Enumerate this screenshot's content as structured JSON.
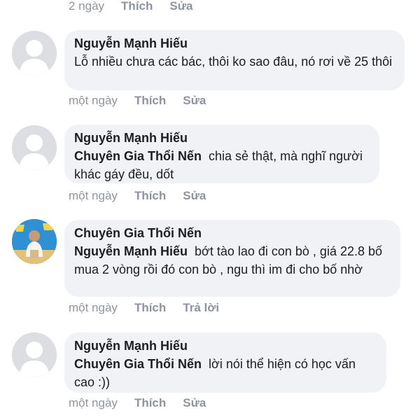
{
  "comments": [
    {
      "time": "2 ngày",
      "actions": [
        "Thích",
        "Sửa"
      ]
    },
    {
      "author": "Nguyễn Mạnh Hiếu",
      "mention": "",
      "text": "Lỗ nhiều chưa các bác, thôi ko sao đâu, nó rơi về 25 thôi",
      "time": "một ngày",
      "actions": [
        "Thích",
        "Sửa"
      ],
      "avatar": "default-avatar-icon"
    },
    {
      "author": "Nguyễn Mạnh Hiếu",
      "mention": "Chuyên Gia Thổi Nến",
      "text": "chia sẻ thật, mà nghĩ người khác gáy đều, dốt",
      "time": "một ngày",
      "actions": [
        "Thích",
        "Sửa"
      ],
      "avatar": "default-avatar-icon"
    },
    {
      "author": "Chuyên Gia Thổi Nến",
      "mention": "Nguyễn Mạnh Hiếu",
      "text": "bớt tào lao đi con bò , giá 22.8 bố mua 2 vòng rồi đó con bò , ngu thì im đi cho bố nhờ",
      "time": "một ngày",
      "actions": [
        "Thích",
        "Trả lời"
      ],
      "avatar": "profile-photo-avatar"
    },
    {
      "author": "Nguyễn Mạnh Hiếu",
      "mention": "Chuyên Gia Thổi Nến",
      "text": "lời nói thể hiện có học vấn cao :))",
      "time": "một ngày",
      "actions": [
        "Thích",
        "Sửa"
      ],
      "avatar": "default-avatar-icon"
    }
  ],
  "colors": {
    "bubble": "#f0f2f5",
    "meta": "#90949c",
    "text": "#1c1e21"
  }
}
